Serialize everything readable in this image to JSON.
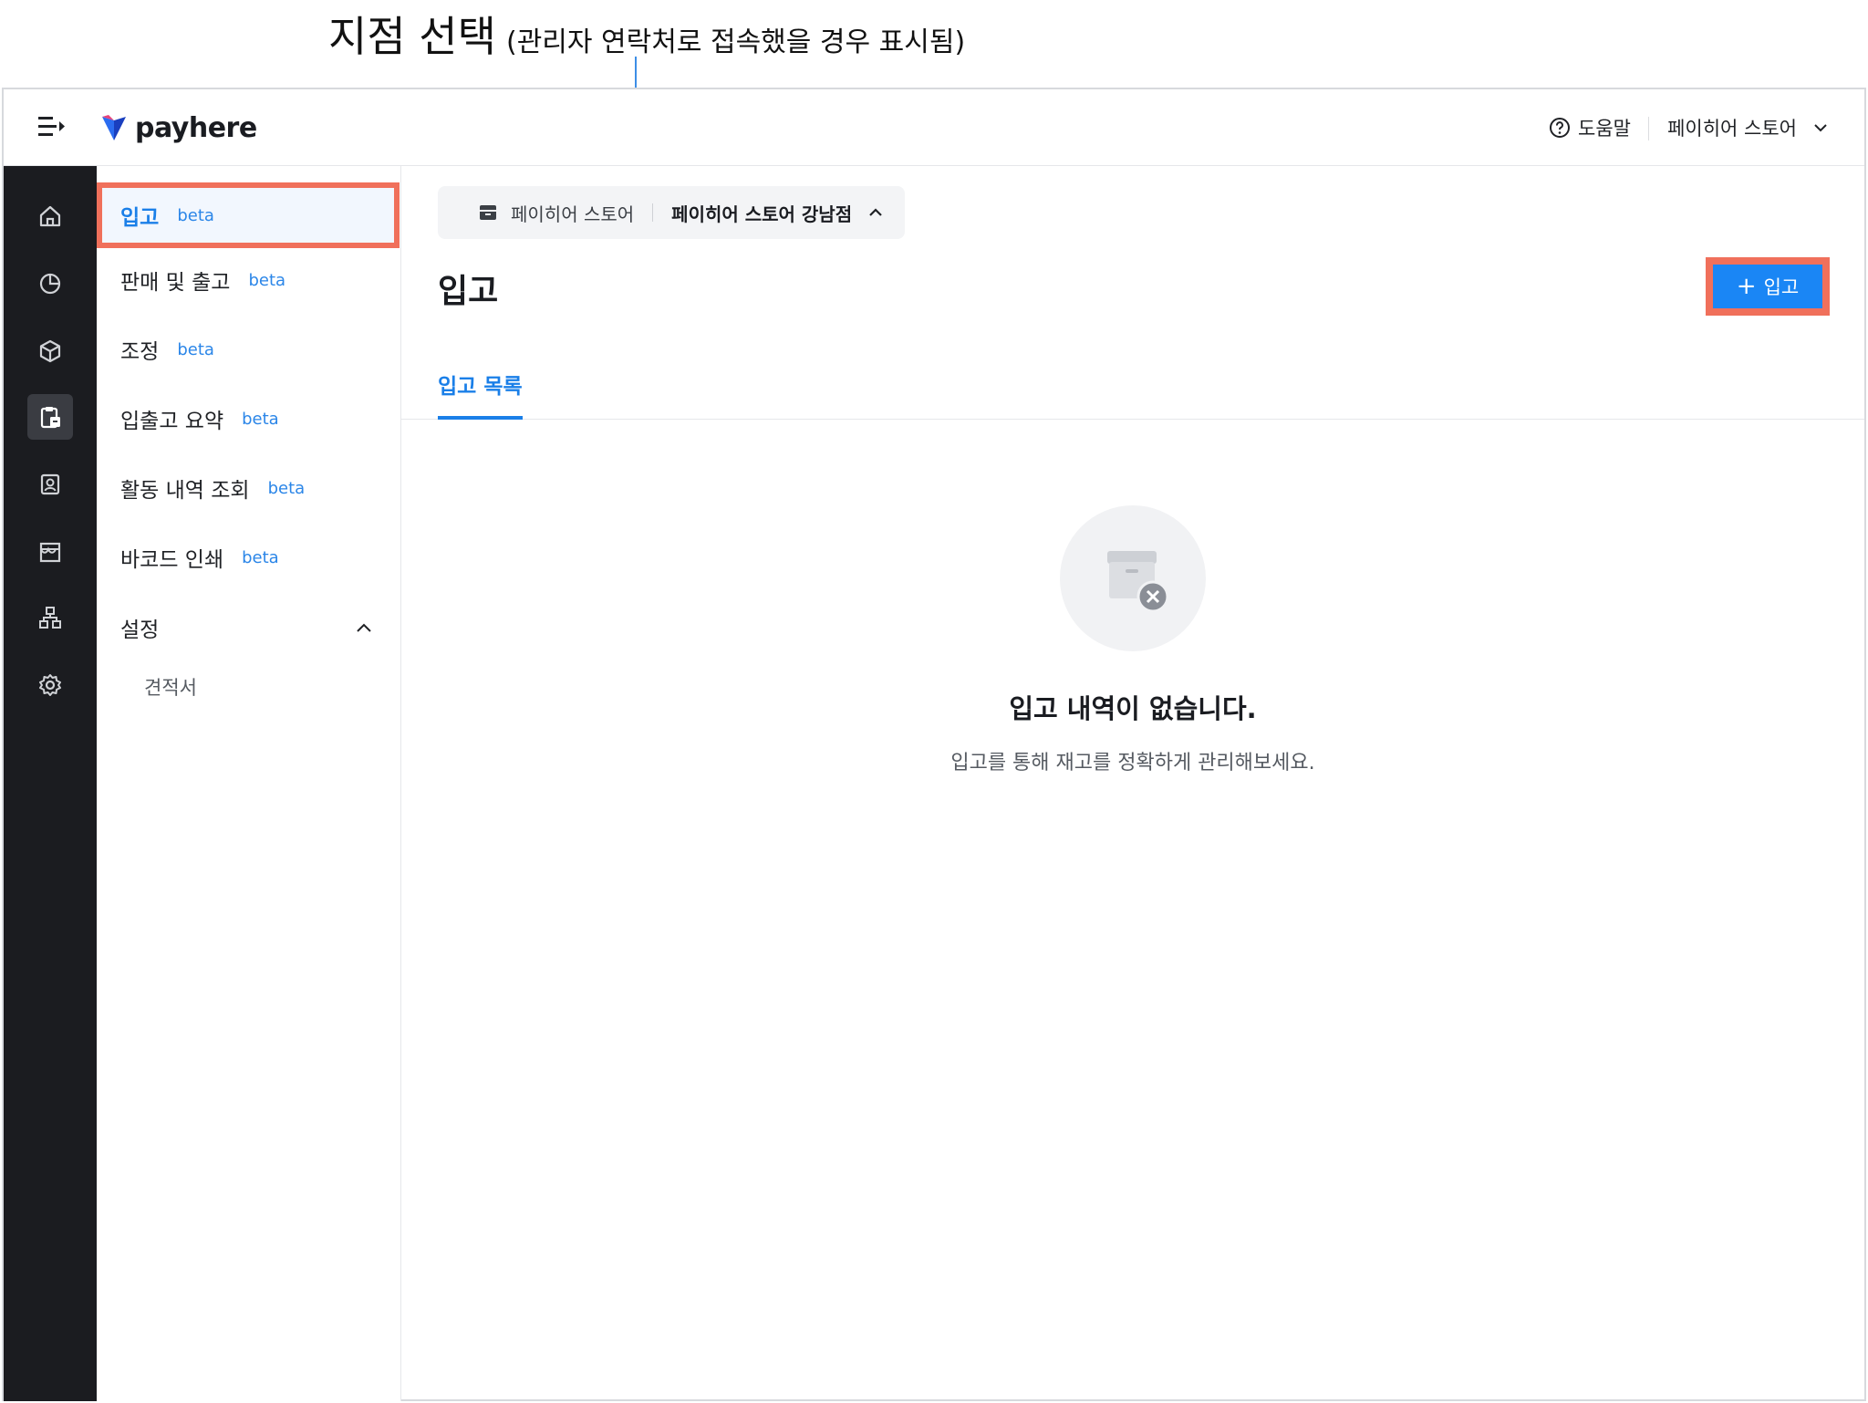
{
  "annotation": {
    "title": "지점 선택",
    "subtitle": "(관리자 연락처로 접속했을 경우 표시됨)"
  },
  "header": {
    "logo_text": "payhere",
    "help_label": "도움말",
    "account_label": "페이히어 스토어"
  },
  "rail": {
    "icons": [
      "home-icon",
      "chart-pie-icon",
      "box-icon",
      "clipboard-icon",
      "contact-card-icon",
      "storefront-icon",
      "org-tree-icon",
      "gear-icon"
    ],
    "active_index": 3
  },
  "subnav": {
    "items": [
      {
        "label": "입고",
        "badge": "beta"
      },
      {
        "label": "판매 및 출고",
        "badge": "beta"
      },
      {
        "label": "조정",
        "badge": "beta"
      },
      {
        "label": "입출고 요약",
        "badge": "beta"
      },
      {
        "label": "활동 내역 조회",
        "badge": "beta"
      },
      {
        "label": "바코드 인쇄",
        "badge": "beta"
      }
    ],
    "group": {
      "label": "설정",
      "children": [
        "견적서"
      ]
    }
  },
  "main": {
    "branch_selector": {
      "store": "페이히어 스토어",
      "branch": "페이히어 스토어 강남점"
    },
    "title": "입고",
    "add_button": {
      "plus": "+",
      "label": "입고"
    },
    "tab": "입고 목록",
    "empty_state": {
      "title": "입고 내역이 없습니다.",
      "description": "입고를 통해 재고를 정확하게 관리해보세요."
    }
  },
  "colors": {
    "accent": "#1a86f5",
    "highlight": "#f0705b",
    "rail_bg": "#1b1c20",
    "callout": "#3d8ee6"
  }
}
